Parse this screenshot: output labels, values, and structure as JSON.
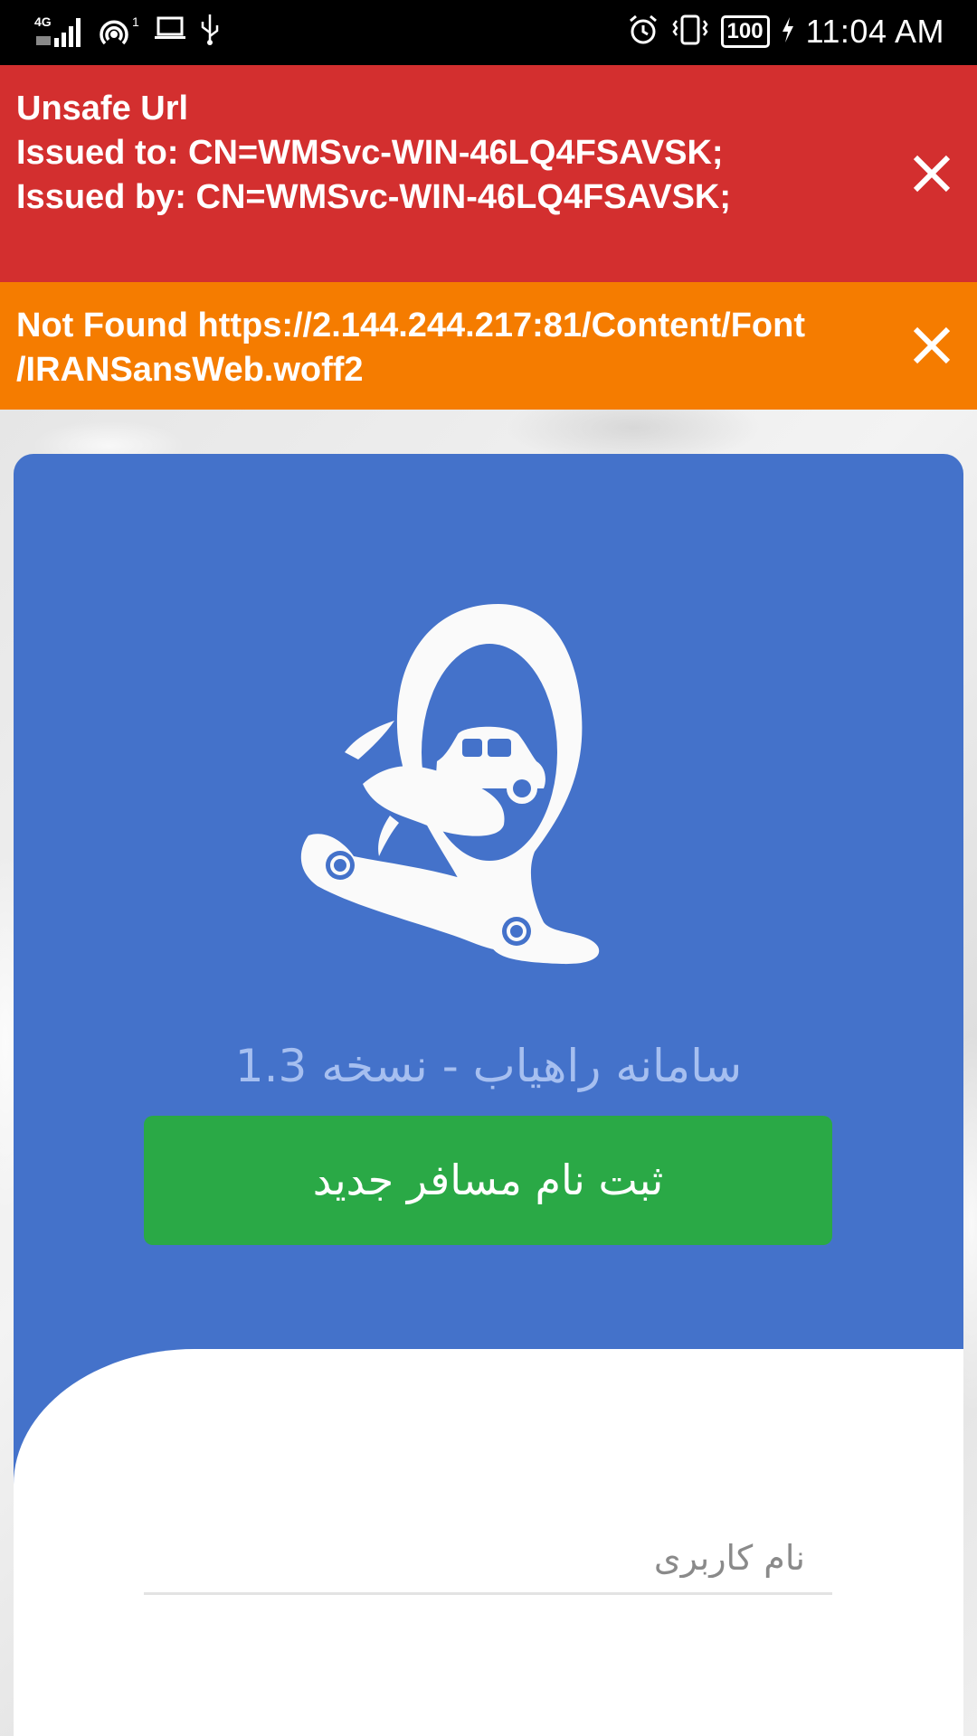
{
  "status_bar": {
    "network": "4G",
    "hotspot_count": "1",
    "battery": "100",
    "time": "11:04 AM"
  },
  "alerts": {
    "unsafe": {
      "lines": [
        "Unsafe Url",
        "Issued to: CN=WMSvc-WIN-46LQ4FSAVSK;",
        "Issued by: CN=WMSvc-WIN-46LQ4FSAVSK;"
      ],
      "color": "#d32f2f"
    },
    "not_found": {
      "lines": [
        "Not Found https://2.144.244.217:81/Content/Font",
        "/IRANSansWeb.woff2"
      ],
      "color": "#f57c00"
    }
  },
  "app": {
    "version_label": "سامانه راهیاب - نسخه 1.3",
    "register_button": "ثبت نام مسافر جدید",
    "username_placeholder": "نام کاربری",
    "primary_color": "#4472ca",
    "button_color": "#2aa946"
  }
}
